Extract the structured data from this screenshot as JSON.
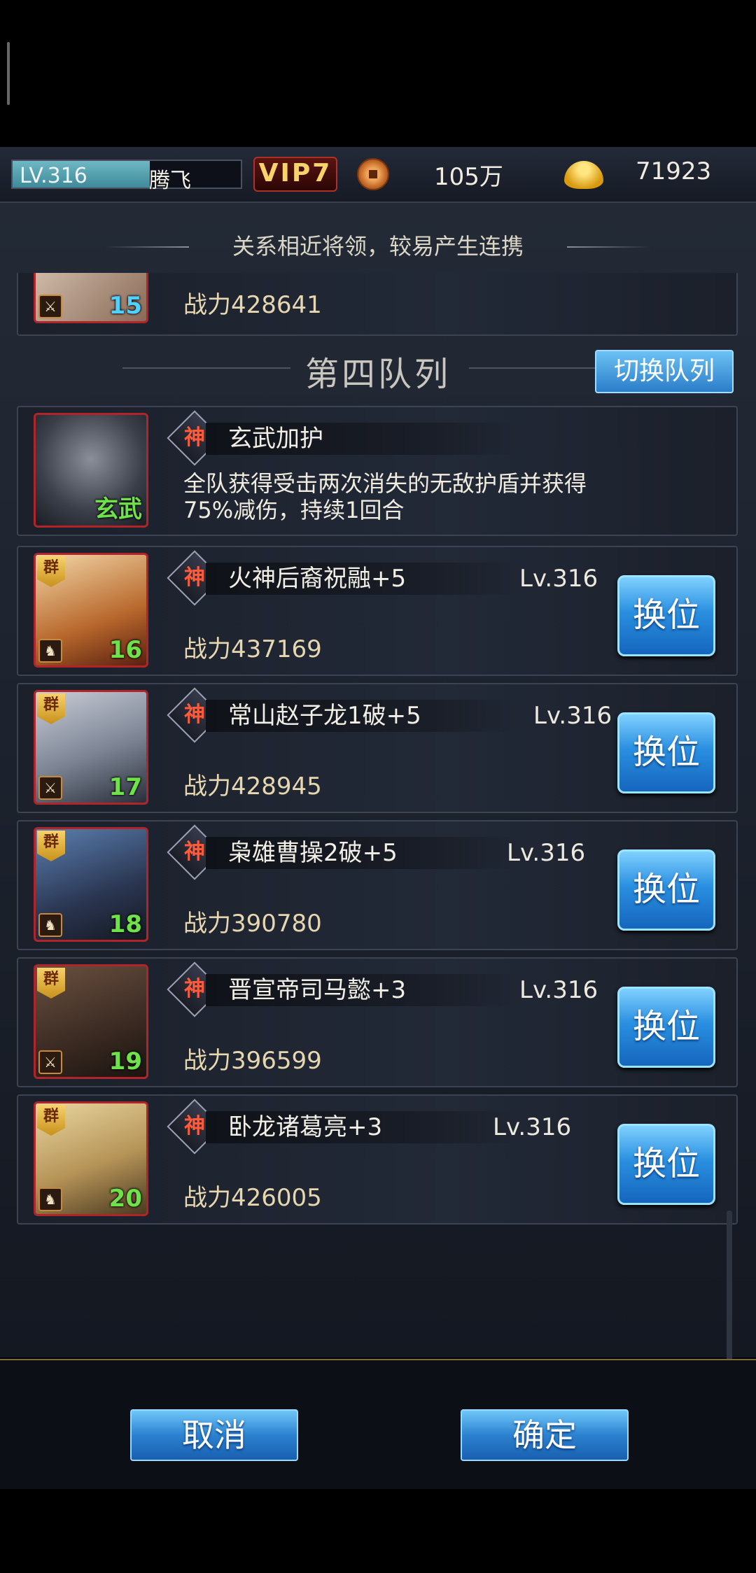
{
  "player": {
    "level": "LV.316",
    "level_progress": 0.6,
    "name": "腾飞",
    "vip": "VIP7",
    "coins": "105万",
    "gold": "71923"
  },
  "hint": "关系相近将领，较易产生连携",
  "partial_card": {
    "slot": "15",
    "power": "战力428641"
  },
  "queue": {
    "title": "第四队列",
    "switch_label": "切换队列"
  },
  "beast": {
    "name": "玄武加护",
    "label": "玄武",
    "desc_line1": "全队获得受击两次消失的无敌护盾并获得",
    "desc_line2": "75%减伤，持续1回合",
    "shen": "神"
  },
  "heroes": [
    {
      "faction": "群",
      "shen": "神",
      "name": "火神后裔祝融+5",
      "level": "Lv.316",
      "power": "战力437169",
      "slot": "16",
      "swap": "换位"
    },
    {
      "faction": "群",
      "shen": "神",
      "name": "常山赵子龙1破+5",
      "level": "Lv.316",
      "power": "战力428945",
      "slot": "17",
      "swap": "换位"
    },
    {
      "faction": "群",
      "shen": "神",
      "name": "枭雄曹操2破+5",
      "level": "Lv.316",
      "power": "战力390780",
      "slot": "18",
      "swap": "换位"
    },
    {
      "faction": "群",
      "shen": "神",
      "name": "晋宣帝司马懿+3",
      "level": "Lv.316",
      "power": "战力396599",
      "slot": "19",
      "swap": "换位"
    },
    {
      "faction": "群",
      "shen": "神",
      "name": "卧龙诸葛亮+3",
      "level": "Lv.316",
      "power": "战力426005",
      "slot": "20",
      "swap": "换位"
    }
  ],
  "buttons": {
    "cancel": "取消",
    "confirm": "确定"
  },
  "icons": {
    "coin": "copper-coin-icon",
    "gold": "gold-ingot-icon",
    "shen": "divine-rank-icon",
    "faction": "faction-badge-icon",
    "class": "unit-class-icon"
  },
  "colors": {
    "accent_blue": "#2a8fe0",
    "slot_green": "#6fe24a",
    "avatar_border": "#b0252a",
    "vip_gold": "#f8d36a"
  }
}
